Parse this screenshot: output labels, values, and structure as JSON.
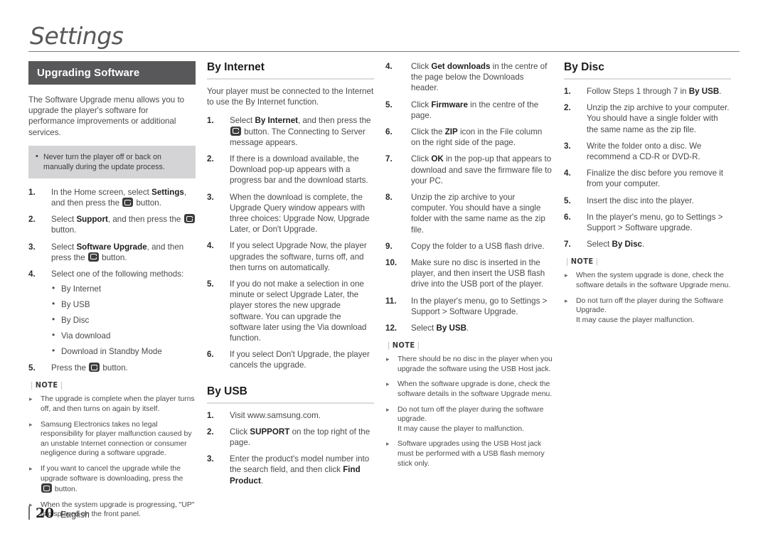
{
  "header": {
    "chapter_title": "Settings"
  },
  "section": {
    "title": "Upgrading Software",
    "intro": "The Software Upgrade menu allows you to upgrade the player's software for performance improvements or additional services.",
    "caution_box": [
      "Never turn the player off or back on manually during the update process."
    ],
    "steps": [
      {
        "num": "1.",
        "html": "In the Home screen, select <b>Settings</b>, and then press the <ICON> button."
      },
      {
        "num": "2.",
        "html": "Select <b>Support</b>, and then press the <ICON> button."
      },
      {
        "num": "3.",
        "html": "Select <b>Software Upgrade</b>, and then press the <ICON> button."
      },
      {
        "num": "4.",
        "html": "Select one of the following methods:"
      },
      {
        "num": "5.",
        "html": "Press the <ICON> button."
      }
    ],
    "methods": [
      "By Internet",
      "By USB",
      "By Disc",
      "Via download",
      "Download in Standby Mode"
    ],
    "note_label": "NOTE",
    "notes": [
      "The upgrade is complete when the player turns off, and then turns on again by itself.",
      "Samsung Electronics takes no legal responsibility for player malfunction caused by an unstable Internet connection or consumer negligence during a software upgrade.",
      "If you want to cancel the upgrade while the upgrade software is downloading, press the <ICON> button.",
      "When the system upgrade is progressing, \"UP\" is displayed on the front panel."
    ]
  },
  "by_internet": {
    "heading": "By Internet",
    "intro": "Your player must be connected to the Internet to use the By Internet function.",
    "steps": [
      {
        "num": "1.",
        "html": "Select <b>By Internet</b>, and then press the <ICON> button. The Connecting to Server message appears."
      },
      {
        "num": "2.",
        "html": "If there is a download available, the Download pop-up appears with a progress bar and the download starts."
      },
      {
        "num": "3.",
        "html": "When the download is complete, the Upgrade Query window appears with three choices: Upgrade Now, Upgrade Later, or Don't Upgrade."
      },
      {
        "num": "4.",
        "html": "If you select Upgrade Now, the player upgrades the software, turns off, and then turns on automatically."
      },
      {
        "num": "5.",
        "html": "If you do not make a selection in one minute or select Upgrade Later, the player stores the new upgrade software. You can upgrade the software later using the Via download function."
      },
      {
        "num": "6.",
        "html": "If you select Don't Upgrade, the player cancels the upgrade."
      }
    ]
  },
  "by_usb": {
    "heading": "By USB",
    "steps_col2": [
      {
        "num": "1.",
        "html": "Visit www.samsung.com."
      },
      {
        "num": "2.",
        "html": "Click <b>SUPPORT</b> on the top right of the page."
      },
      {
        "num": "3.",
        "html": "Enter the product's model number into the search field, and then click <b>Find Product</b>."
      }
    ],
    "steps_col3": [
      {
        "num": "4.",
        "html": "Click <b>Get downloads</b> in the centre of the page below the Downloads header."
      },
      {
        "num": "5.",
        "html": "Click <b>Firmware</b> in the centre of the page."
      },
      {
        "num": "6.",
        "html": "Click the <b>ZIP</b> icon in the File column on the right side of the page."
      },
      {
        "num": "7.",
        "html": "Click <b>OK</b> in the pop-up that appears to download and save the firmware file to your PC."
      },
      {
        "num": "8.",
        "html": "Unzip the zip archive to your computer. You should have a single folder with the same name as the zip file."
      },
      {
        "num": "9.",
        "html": "Copy the folder to a USB flash drive."
      },
      {
        "num": "10.",
        "html": "Make sure no disc is inserted in the player, and then insert the USB flash drive into the USB port of the player."
      },
      {
        "num": "11.",
        "html": "In the player's menu, go to Settings &gt; Support &gt; Software Upgrade."
      },
      {
        "num": "12.",
        "html": "Select <b>By USB</b>."
      }
    ],
    "note_label": "NOTE",
    "notes": [
      "There should be no disc in the player when you upgrade the software using the USB Host jack.",
      "When the software upgrade is done, check the software details in the software Upgrade menu.",
      "Do not turn off the player during the software upgrade.<br>It may cause the player to malfunction.",
      "Software upgrades using the USB Host jack must be performed with a USB flash memory stick only."
    ]
  },
  "by_disc": {
    "heading": "By Disc",
    "steps": [
      {
        "num": "1.",
        "html": "Follow Steps 1 through 7 in <b>By USB</b>."
      },
      {
        "num": "2.",
        "html": "Unzip the zip archive to your computer. You should have a single folder with the same name as the zip file."
      },
      {
        "num": "3.",
        "html": "Write the folder onto a disc. We recommend a CD-R or DVD-R."
      },
      {
        "num": "4.",
        "html": "Finalize the disc before you remove it from your computer."
      },
      {
        "num": "5.",
        "html": "Insert the disc into the player."
      },
      {
        "num": "6.",
        "html": "In the player's menu, go to Settings &gt; Support &gt; Software upgrade."
      },
      {
        "num": "7.",
        "html": "Select <b>By Disc</b>."
      }
    ],
    "note_label": "NOTE",
    "notes": [
      "When the system upgrade is done, check the software details in the software Upgrade menu.",
      "Do not turn off the player during the Software Upgrade.<br>It may cause the player malfunction."
    ]
  },
  "footer": {
    "page_number": "20",
    "language": "English"
  },
  "colors": {
    "titlebar_bg": "#58585a",
    "callout_bg": "#d4d4d6",
    "heading_rule": "#dcdcdc",
    "text": "#4a4a4a"
  },
  "icons": {
    "enter_button": "enter-button-icon"
  }
}
